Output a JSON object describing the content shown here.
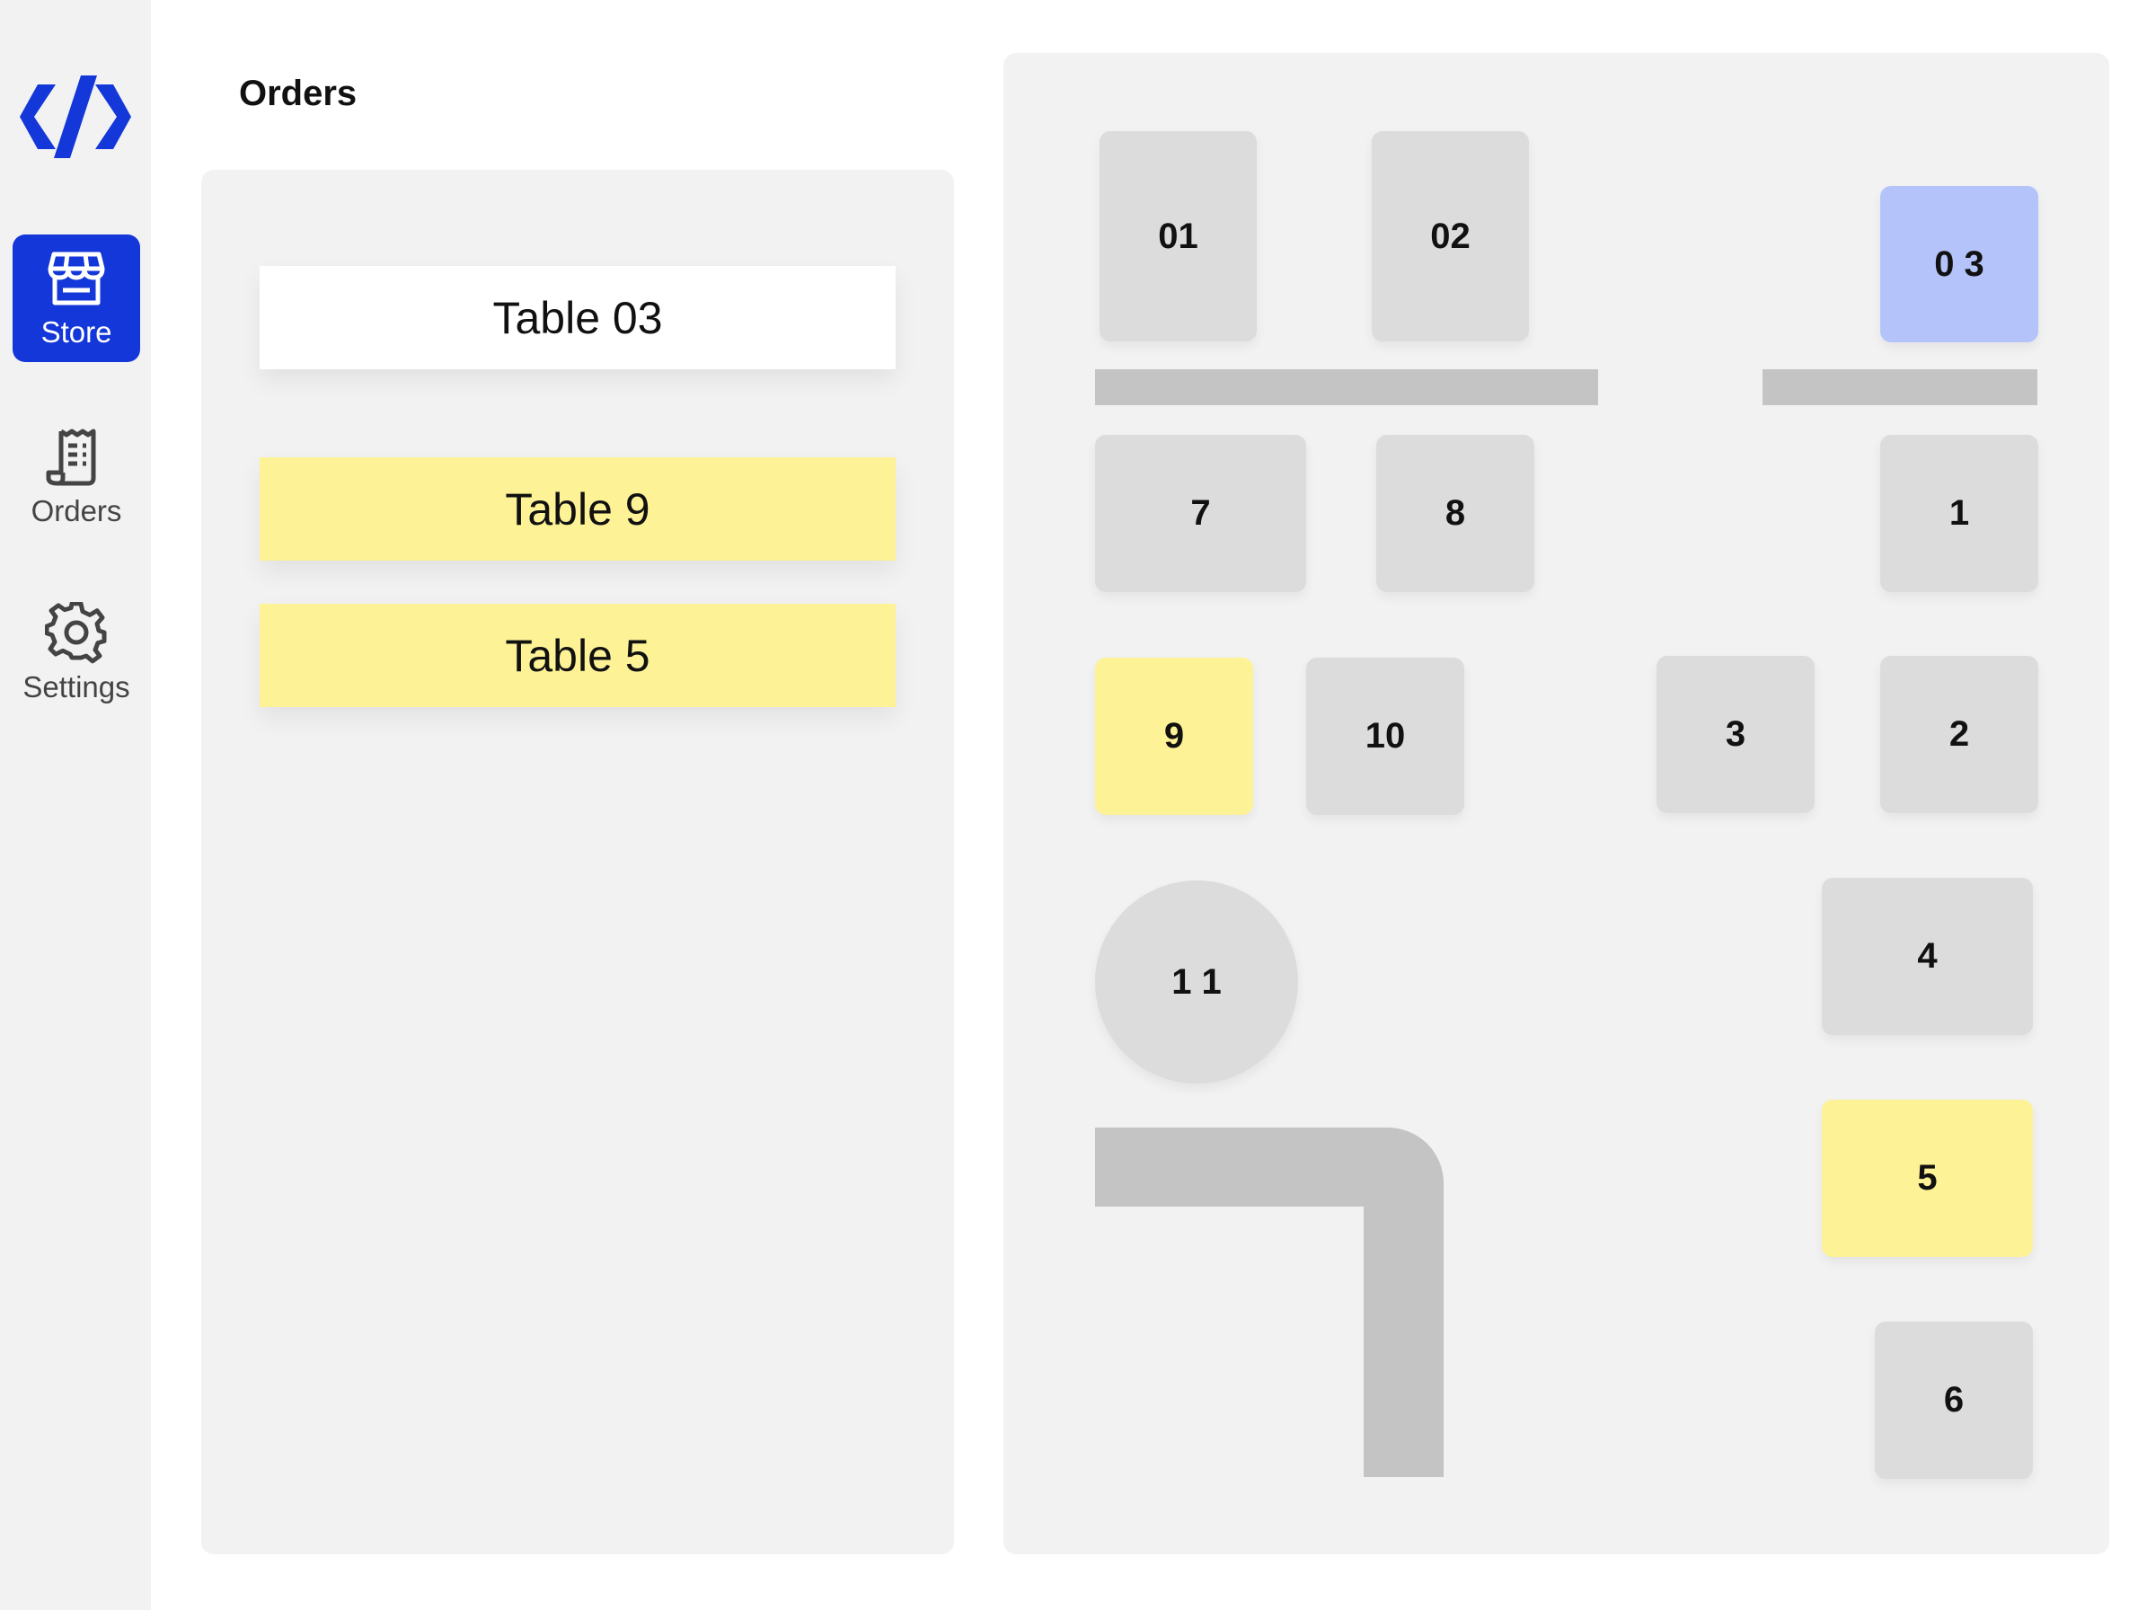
{
  "sidebar": {
    "items": [
      {
        "label": "Store",
        "icon": "store-icon",
        "active": true
      },
      {
        "label": "Orders",
        "icon": "receipt-icon",
        "active": false
      },
      {
        "label": "Settings",
        "icon": "gear-icon",
        "active": false
      }
    ]
  },
  "header": {
    "title": "Orders"
  },
  "orders": [
    {
      "label": "Table 03",
      "state": "selected"
    },
    {
      "label": "Table 9",
      "state": "pending"
    },
    {
      "label": "Table 5",
      "state": "pending"
    }
  ],
  "floor": {
    "tables": [
      {
        "label": "01",
        "state": "free"
      },
      {
        "label": "02",
        "state": "free"
      },
      {
        "label": "0 3",
        "state": "selected"
      },
      {
        "label": "7",
        "state": "free"
      },
      {
        "label": "8",
        "state": "free"
      },
      {
        "label": "1",
        "state": "free"
      },
      {
        "label": "9",
        "state": "pending"
      },
      {
        "label": "10",
        "state": "free"
      },
      {
        "label": "3",
        "state": "free"
      },
      {
        "label": "2",
        "state": "free"
      },
      {
        "label": "1 1",
        "state": "free"
      },
      {
        "label": "4",
        "state": "free"
      },
      {
        "label": "5",
        "state": "pending"
      },
      {
        "label": "6",
        "state": "free"
      }
    ]
  },
  "colors": {
    "accent": "#1337d8",
    "selected_table": "#b4c4fb",
    "pending": "#fdf295",
    "table_free": "#dcdcdc",
    "counter": "#c4c4c4",
    "panel_bg": "#f2f2f2"
  }
}
